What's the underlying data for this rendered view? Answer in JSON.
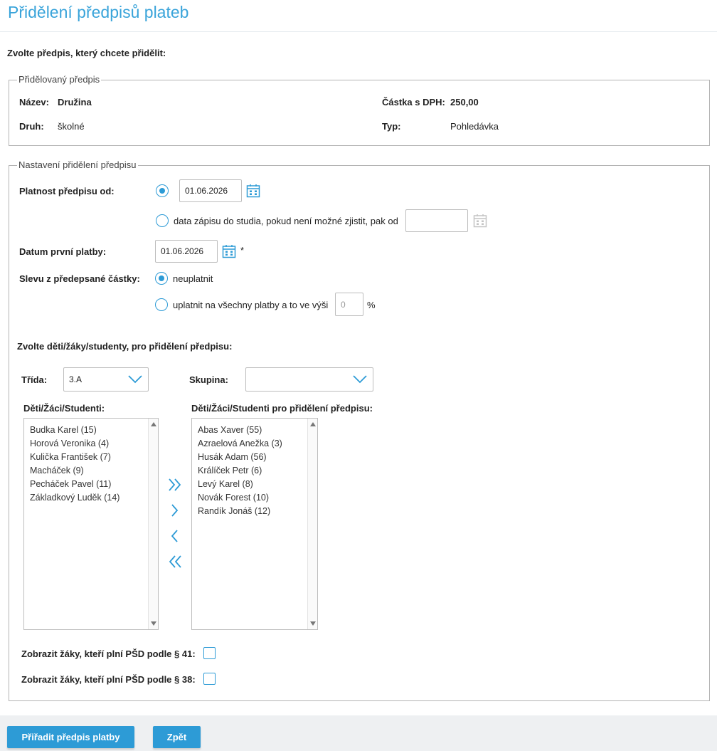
{
  "page": {
    "title": "Přidělení předpisů plateb"
  },
  "intro": {
    "choose_label": "Zvolte předpis, který chcete přidělit:"
  },
  "assigned": {
    "legend": "Přidělovaný předpis",
    "name_label": "Název:",
    "name_value": "Družina",
    "amount_label": "Částka s DPH:",
    "amount_value": "250,00",
    "kind_label": "Druh:",
    "kind_value": "školné",
    "type_label": "Typ:",
    "type_value": "Pohledávka"
  },
  "settings": {
    "legend": "Nastavení přidělení předpisu",
    "validity_label": "Platnost předpisu od:",
    "validity_date": "01.06.2026",
    "enrollment_option": "data zápisu do studia, pokud není možné zjistit, pak od",
    "enrollment_date": "",
    "first_payment_label": "Datum první platby:",
    "first_payment_date": "01.06.2026",
    "required_mark": "*",
    "discount_label": "Slevu z předepsané částky:",
    "discount_option_none": "neuplatnit",
    "discount_option_apply": "uplatnit na všechny platby a to ve výši",
    "discount_value": "0",
    "percent": "%"
  },
  "students": {
    "choose_label": "Zvolte děti/žáky/studenty, pro přidělení předpisu:",
    "class_label": "Třída:",
    "class_value": "3.A",
    "group_label": "Skupina:",
    "group_value": "",
    "available_label": "Děti/Žáci/Studenti:",
    "available": [
      "Budka Karel (15)",
      "Horová Veronika (4)",
      "Kulička František (7)",
      "Macháček (9)",
      "Pecháček Pavel (11)",
      "Základkový Luděk (14)"
    ],
    "selected_label": "Děti/Žáci/Studenti pro přidělení předpisu:",
    "selected": [
      "Abas Xaver (55)",
      "Azraelová Anežka (3)",
      "Husák Adam (56)",
      "Králíček Petr (6)",
      "Levý Karel (8)",
      "Novák Forest (10)",
      "Randík Jonáš (12)"
    ],
    "show_41_label": "Zobrazit žáky, kteří plní PŠD podle § 41:",
    "show_38_label": "Zobrazit žáky, kteří plní PŠD podle § 38:"
  },
  "footer": {
    "assign_button": "Přiřadit předpis platby",
    "back_button": "Zpět"
  },
  "colors": {
    "accent": "#2d9bd6",
    "title": "#3aa4da",
    "footer_bg": "#eef0f2"
  },
  "icons": {
    "calendar": "calendar-icon",
    "move_all_right": "double-chevron-right-icon",
    "move_right": "chevron-right-icon",
    "move_left": "chevron-left-icon",
    "move_all_left": "double-chevron-left-icon",
    "dropdown": "chevron-down-icon"
  }
}
